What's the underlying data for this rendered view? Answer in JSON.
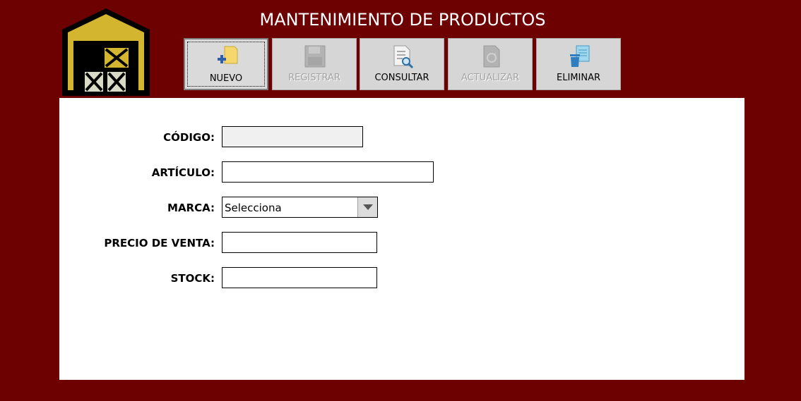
{
  "window": {
    "title": "MANTENIMIENTO DE PRODUCTOS",
    "background_color": "#6d0000"
  },
  "toolbar": {
    "nuevo": {
      "label": "NUEVO",
      "icon": "new-document-icon",
      "enabled": true
    },
    "registrar": {
      "label": "REGISTRAR",
      "icon": "save-disk-icon",
      "enabled": false
    },
    "consultar": {
      "label": "CONSULTAR",
      "icon": "search-document-icon",
      "enabled": true
    },
    "actualizar": {
      "label": "ACTUALIZAR",
      "icon": "update-icon",
      "enabled": false
    },
    "eliminar": {
      "label": "ELIMINAR",
      "icon": "trash-icon",
      "enabled": true
    }
  },
  "form": {
    "codigo": {
      "label": "CÓDIGO:",
      "value": ""
    },
    "articulo": {
      "label": "ARTÍCULO:",
      "value": ""
    },
    "marca": {
      "label": "MARCA:",
      "value": "Selecciona"
    },
    "precio": {
      "label": "PRECIO DE VENTA:",
      "value": ""
    },
    "stock": {
      "label": "STOCK:",
      "value": ""
    }
  }
}
